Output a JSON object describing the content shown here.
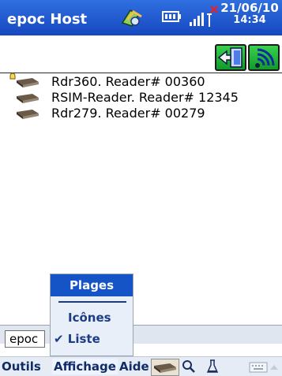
{
  "titlebar": {
    "title": "epoc Host",
    "date": "21/06/10",
    "time": "14:34"
  },
  "toolbar": {
    "buttons": [
      "exit",
      "wireless"
    ]
  },
  "readers": [
    {
      "label": "Rdr360. Reader# 00360",
      "marked": true
    },
    {
      "label": "RSIM-Reader. Reader# 12345",
      "marked": false
    },
    {
      "label": "Rdr279. Reader# 00279",
      "marked": false
    }
  ],
  "input": {
    "value": "epoc"
  },
  "popup": {
    "header": "Plages",
    "items": [
      {
        "label": "Icônes"
      },
      {
        "label": "✔ Liste"
      }
    ]
  },
  "menubar": {
    "outils": "Outils",
    "affichage": "Affichage",
    "aide": "Aide"
  },
  "colors": {
    "titlebar": "#1f5ad6",
    "accent": "#1554c7",
    "menu_text": "#112b66"
  }
}
